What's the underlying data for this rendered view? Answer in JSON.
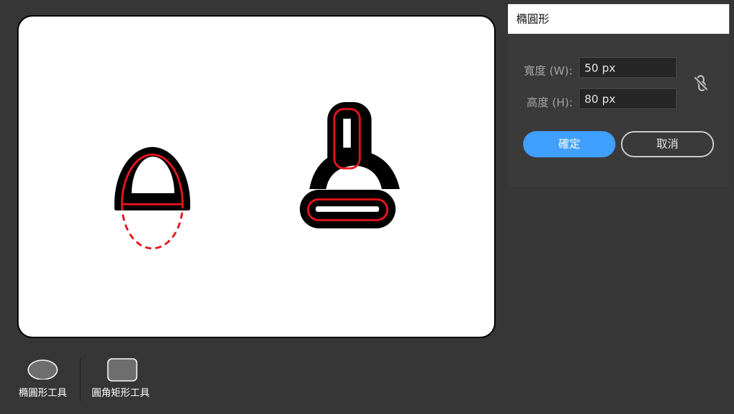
{
  "dialog": {
    "title": "橢圓形",
    "width_label": "寬度 (W):",
    "width_value": "50 px",
    "height_label": "高度 (H):",
    "height_value": "80 px",
    "link_icon": "unlink-icon",
    "ok_label": "確定",
    "cancel_label": "取消",
    "accent_color": "#3fa0ff"
  },
  "toolbar": {
    "ellipse_tool_label": "橢圓形工具",
    "rounded_rect_tool_label": "圓角矩形工具"
  },
  "colors": {
    "background": "#363636",
    "shape_fill": "#000000",
    "outline": "#e8141c"
  }
}
